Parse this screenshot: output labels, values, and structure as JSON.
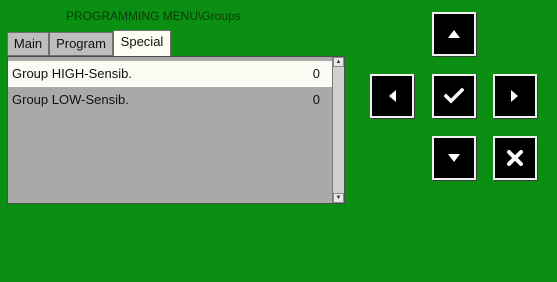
{
  "window": {
    "title": "PROGRAMMING MENU\\Groups"
  },
  "tabs": [
    {
      "label": "Main",
      "active": false
    },
    {
      "label": "Program",
      "active": false
    },
    {
      "label": "Special",
      "active": true
    }
  ],
  "list": {
    "rows": [
      {
        "label": "Group HIGH-Sensib.",
        "value": "0",
        "selected": true
      },
      {
        "label": "Group LOW-Sensib.",
        "value": "0",
        "selected": false
      }
    ]
  },
  "keypad": {
    "up": "up-arrow-icon",
    "left": "left-arrow-icon",
    "ok": "checkmark-icon",
    "right": "right-arrow-icon",
    "down": "down-arrow-icon",
    "cancel": "cancel-x-icon"
  },
  "colors": {
    "background": "#0a8f12",
    "panel": "#a9a9a9",
    "selected_row": "#fbfbf3",
    "key": "#000000"
  }
}
